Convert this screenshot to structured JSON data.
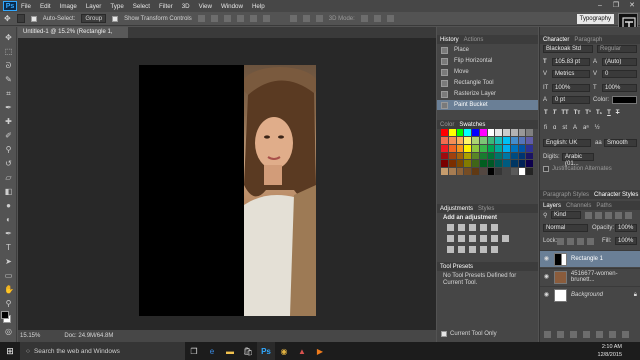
{
  "app": {
    "name": "Ps",
    "menu": [
      "File",
      "Edit",
      "Image",
      "Layer",
      "Type",
      "Select",
      "Filter",
      "3D",
      "View",
      "Window",
      "Help"
    ],
    "window_controls": [
      "–",
      "❐",
      "✕"
    ]
  },
  "options": {
    "auto_select_label": "Auto-Select:",
    "auto_select_value": "Group",
    "transform_label": "Show Transform Controls",
    "mode_3d": "3D Mode:",
    "workspace": "Typography"
  },
  "document": {
    "tab_title": "Untitled-1 @ 15.2% (Rectangle 1, RGB/8) *",
    "zoom": "15.15%",
    "doc_size": "Doc: 24.9M/64.8M"
  },
  "history": {
    "tabs": [
      "History",
      "Actions"
    ],
    "items": [
      "Place",
      "Flip Horizontal",
      "Move",
      "Rectangle Tool",
      "Rasterize Layer",
      "Paint Bucket"
    ]
  },
  "swatches": {
    "tabs": [
      "Color",
      "Swatches"
    ],
    "colors": [
      "#ff0000",
      "#ffff00",
      "#00ff00",
      "#00ffff",
      "#0000ff",
      "#ff00ff",
      "#ffffff",
      "#e6e6e6",
      "#cccccc",
      "#b3b3b3",
      "#999999",
      "#808080",
      "#f26c4f",
      "#f68e56",
      "#fbaf5d",
      "#fff568",
      "#acd372",
      "#7cc576",
      "#3bb878",
      "#1abbb4",
      "#00bff3",
      "#438ccb",
      "#5574b9",
      "#605ca8",
      "#ed1c24",
      "#f26522",
      "#f7941d",
      "#fff200",
      "#8dc63f",
      "#39b54a",
      "#00a651",
      "#00a99d",
      "#00aeef",
      "#0072bc",
      "#0054a6",
      "#2e3192",
      "#9e0b0f",
      "#a0410d",
      "#a36209",
      "#aba000",
      "#598527",
      "#197b30",
      "#007236",
      "#00746b",
      "#0076a3",
      "#004b80",
      "#003471",
      "#1b1464",
      "#790000",
      "#7b2e00",
      "#7d4900",
      "#827b00",
      "#406618",
      "#005e20",
      "#005826",
      "#005952",
      "#005b7f",
      "#003663",
      "#002157",
      "#0d004c",
      "#c69c6d",
      "#a67c52",
      "#8c6239",
      "#754c24",
      "#603913",
      "#534741",
      "#000000",
      "#363636",
      "#464646",
      "#5a5a5a",
      "#ffffff",
      "#242424"
    ]
  },
  "adjustments": {
    "tabs": [
      "Adjustments",
      "Styles"
    ],
    "heading": "Add an adjustment"
  },
  "tool_presets": {
    "title": "Tool Presets",
    "message": "No Tool Presets Defined for Current Tool.",
    "footer": "Current Tool Only"
  },
  "character": {
    "tabs": [
      "Character",
      "Paragraph"
    ],
    "font_family": "Blackoak Std",
    "font_style": "Regular",
    "size": "105.83 pt",
    "leading": "(Auto)",
    "kerning": "Metrics",
    "tracking": "0",
    "vscale": "100%",
    "hscale": "100%",
    "baseline": "0 pt",
    "color_label": "Color:",
    "language": "English: UK",
    "antialias": "Smooth",
    "digits_label": "Digits:",
    "digits_value": "Arabic (01...",
    "justification": "Justification Alternates",
    "bottom_tabs": [
      "Paragraph Styles",
      "Character Styles"
    ]
  },
  "layers": {
    "tabs": [
      "Layers",
      "Channels",
      "Paths"
    ],
    "kind": "Kind",
    "blend": "Normal",
    "opacity_label": "Opacity:",
    "opacity": "100%",
    "lock_label": "Lock:",
    "fill_label": "Fill:",
    "fill": "100%",
    "items": [
      "Rectangle 1",
      "4516677-women-brunett...",
      "Background"
    ]
  },
  "taskbar": {
    "search": "Search the web and Windows",
    "time": "2:10 AM",
    "date": "12/8/2015"
  }
}
